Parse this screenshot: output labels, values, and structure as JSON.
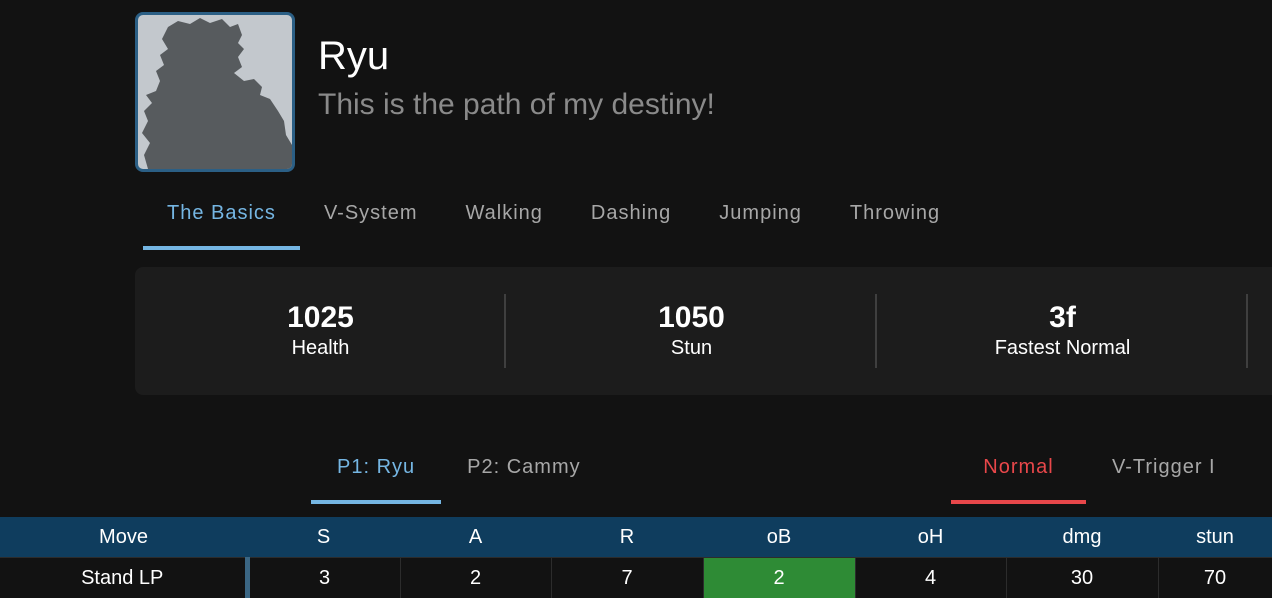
{
  "character": {
    "name": "Ryu",
    "quote": "This is the path of my destiny!",
    "portrait_icon": "character-silhouette"
  },
  "tabs": [
    {
      "label": "The Basics",
      "active": true
    },
    {
      "label": "V-System",
      "active": false
    },
    {
      "label": "Walking",
      "active": false
    },
    {
      "label": "Dashing",
      "active": false
    },
    {
      "label": "Jumping",
      "active": false
    },
    {
      "label": "Throwing",
      "active": false
    }
  ],
  "stats": [
    {
      "value": "1025",
      "label": "Health"
    },
    {
      "value": "1050",
      "label": "Stun"
    },
    {
      "value": "3f",
      "label": "Fastest Normal"
    }
  ],
  "player_tabs": [
    {
      "label": "P1: Ryu",
      "active": true
    },
    {
      "label": "P2: Cammy",
      "active": false
    }
  ],
  "mode_tabs": [
    {
      "label": "Normal",
      "active": true
    },
    {
      "label": "V-Trigger I",
      "active": false
    }
  ],
  "table": {
    "headers": [
      "Move",
      "S",
      "A",
      "R",
      "oB",
      "oH",
      "dmg",
      "stun"
    ],
    "rows": [
      [
        "Stand LP",
        "3",
        "2",
        "7",
        "2",
        "4",
        "30",
        "70"
      ]
    ],
    "highlight_color": "#2e8b35"
  },
  "colors": {
    "accent_blue": "#75b6e3",
    "accent_red": "#e8474a",
    "header_bg": "#0f3d5e"
  }
}
